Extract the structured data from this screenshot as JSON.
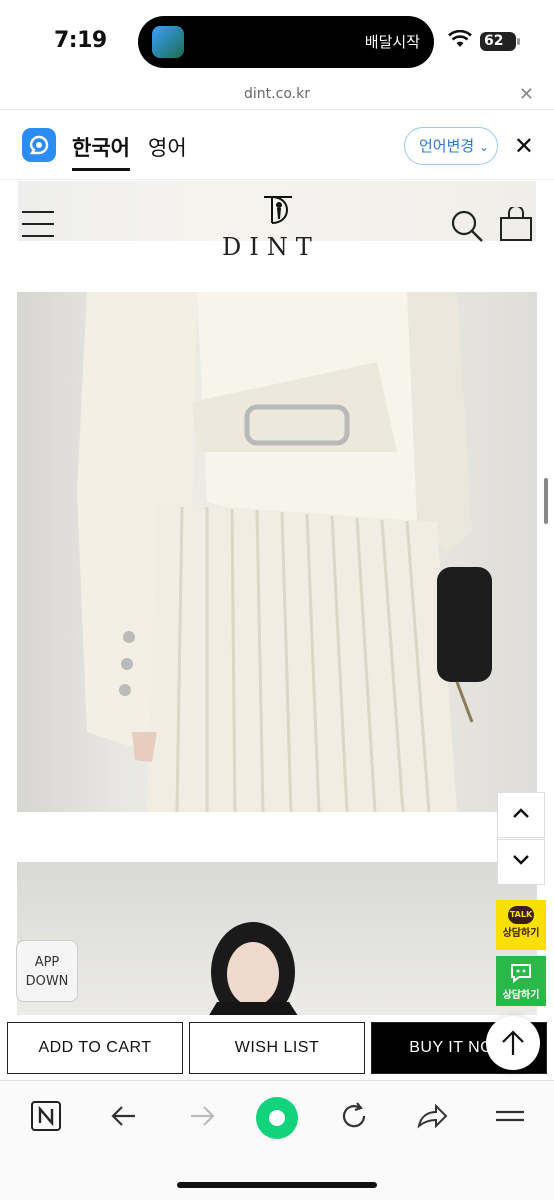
{
  "status_bar": {
    "time": "7:19",
    "activity_text": "배달시작",
    "battery": "62"
  },
  "url_bar": {
    "url": "dint.co.kr",
    "close_icon": "close-icon"
  },
  "translate_bar": {
    "tab_korean": "한국어",
    "tab_english": "영어",
    "change_language": "언어변경",
    "close_icon": "close-icon"
  },
  "header": {
    "brand": "DINT",
    "icons": [
      "hamburger-menu-icon",
      "search-icon",
      "shopping-bag-icon"
    ]
  },
  "floating": {
    "talk_badge": "TALK",
    "talk_label": "상담하기",
    "naver_talk_label": "상담하기",
    "app_down_line1": "APP",
    "app_down_line2": "DOWN"
  },
  "actions": {
    "add_to_cart": "ADD TO CART",
    "wish_list": "WISH LIST",
    "buy_it_now": "BUY IT NOW"
  },
  "toolbar": {
    "icons": [
      "naver-icon",
      "back-icon",
      "forward-icon",
      "home-icon",
      "refresh-icon",
      "share-icon",
      "menu-icon"
    ]
  },
  "colors": {
    "kakao": "#f9e000",
    "naver_green": "#2ab849",
    "translate_blue": "#2b8cf1"
  }
}
